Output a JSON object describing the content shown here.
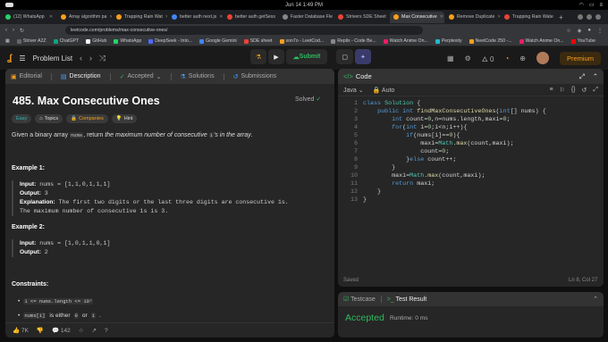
{
  "mac": {
    "time": "Jun 14   1:49 PM"
  },
  "tabs": [
    {
      "label": "(12) WhatsApp",
      "color": "#25d366"
    },
    {
      "label": "Array algorithm pa",
      "color": "#f89f1b"
    },
    {
      "label": "Trapping Rain Wat",
      "color": "#f89f1b"
    },
    {
      "label": "better auth next.js",
      "color": "#4285f4"
    },
    {
      "label": "better auth getSess",
      "color": "#ea4335"
    },
    {
      "label": "Faster Database Fle",
      "color": "#888888"
    },
    {
      "label": "Strivers SDE Sheet",
      "color": "#ea4335"
    },
    {
      "label": "Max Consecutive",
      "color": "#f89f1b",
      "active": true
    },
    {
      "label": "Remove Duplicate",
      "color": "#f89f1b"
    },
    {
      "label": "Trapping Rain Wate",
      "color": "#ea4335"
    }
  ],
  "address": {
    "url": "leetcode.com/problems/max-consecutive-ones/"
  },
  "bookmarks": [
    {
      "label": "Striver A2Z",
      "color": "#666"
    },
    {
      "label": "ChatGPT",
      "color": "#10a37f"
    },
    {
      "label": "GitHub",
      "color": "#fff"
    },
    {
      "label": "WhatsApp",
      "color": "#25d366"
    },
    {
      "label": "DeepSeek - Into...",
      "color": "#4d6bfe"
    },
    {
      "label": "Google Gemini",
      "color": "#4285f4"
    },
    {
      "label": "SDE sheet",
      "color": "#ea4335"
    },
    {
      "label": "son7o - LeetCod...",
      "color": "#f89f1b"
    },
    {
      "label": "Replix - Code Be...",
      "color": "#888"
    },
    {
      "label": "Watch Anime On...",
      "color": "#e91e63"
    },
    {
      "label": "Perplexity",
      "color": "#20b8cd"
    },
    {
      "label": "NeetCode 250 -...",
      "color": "#f89f1b"
    },
    {
      "label": "Watch Anime On...",
      "color": "#e91e63"
    },
    {
      "label": "YouTube",
      "color": "#ff0000"
    }
  ],
  "header": {
    "problem_list": "Problem List",
    "submit": "Submit",
    "streak": "0",
    "premium": "Premium"
  },
  "left_tabs": {
    "editorial": "Editorial",
    "description": "Description",
    "accepted": "Accepted",
    "solutions": "Solutions",
    "submissions": "Submissions"
  },
  "problem": {
    "title": "485. Max Consecutive Ones",
    "solved": "Solved",
    "chips": {
      "easy": "Easy",
      "topics": "Topics",
      "companies": "Companies",
      "hint": "Hint"
    },
    "desc_pre": "Given a binary array",
    "desc_code": "nums",
    "desc_mid": ", return",
    "desc_em": "the maximum number of consecutive",
    "desc_code2": "1",
    "desc_em2": "'s in the array",
    "desc_end": "."
  },
  "example1": {
    "heading": "Example 1:",
    "input_label": "Input:",
    "input": "nums = [1,1,0,1,1,1]",
    "output_label": "Output:",
    "output": "3",
    "expl_label": "Explanation:",
    "expl1": "The first two digits or the last three digits are consecutive 1s.",
    "expl2": "The maximum number of consecutive 1s is 3."
  },
  "example2": {
    "heading": "Example 2:",
    "input_label": "Input:",
    "input": "nums = [1,0,1,1,0,1]",
    "output_label": "Output:",
    "output": "2"
  },
  "constraints": {
    "heading": "Constraints:",
    "c1": "1 <= nums.length <= 10⁵",
    "c2_code": "nums[i]",
    "c2_mid": "is either",
    "c2_a": "0",
    "c2_or": "or",
    "c2_b": "1",
    "c2_end": "."
  },
  "footer": {
    "likes": "7K",
    "comments": "142"
  },
  "editor": {
    "title": "Code",
    "language": "Java",
    "auto": "Auto",
    "saved": "Saved",
    "position": "Ln 8, Col 27",
    "lines": [
      "class Solution {",
      "    public int findMaxConsecutiveOnes(int[] nums) {",
      "        int count=0,n=nums.length,maxi=0;",
      "        for(int i=0;i<n;i++){",
      "            if(nums[i]==0){",
      "                maxi=Math.max(count,maxi);",
      "                count=0;",
      "            }else count++;",
      "        }",
      "        maxi=Math.max(count,maxi);",
      "        return maxi;",
      "    }",
      "}"
    ]
  },
  "test": {
    "testcase": "Testcase",
    "result": "Test Result",
    "status": "Accepted",
    "runtime": "Runtime: 0 ms"
  }
}
